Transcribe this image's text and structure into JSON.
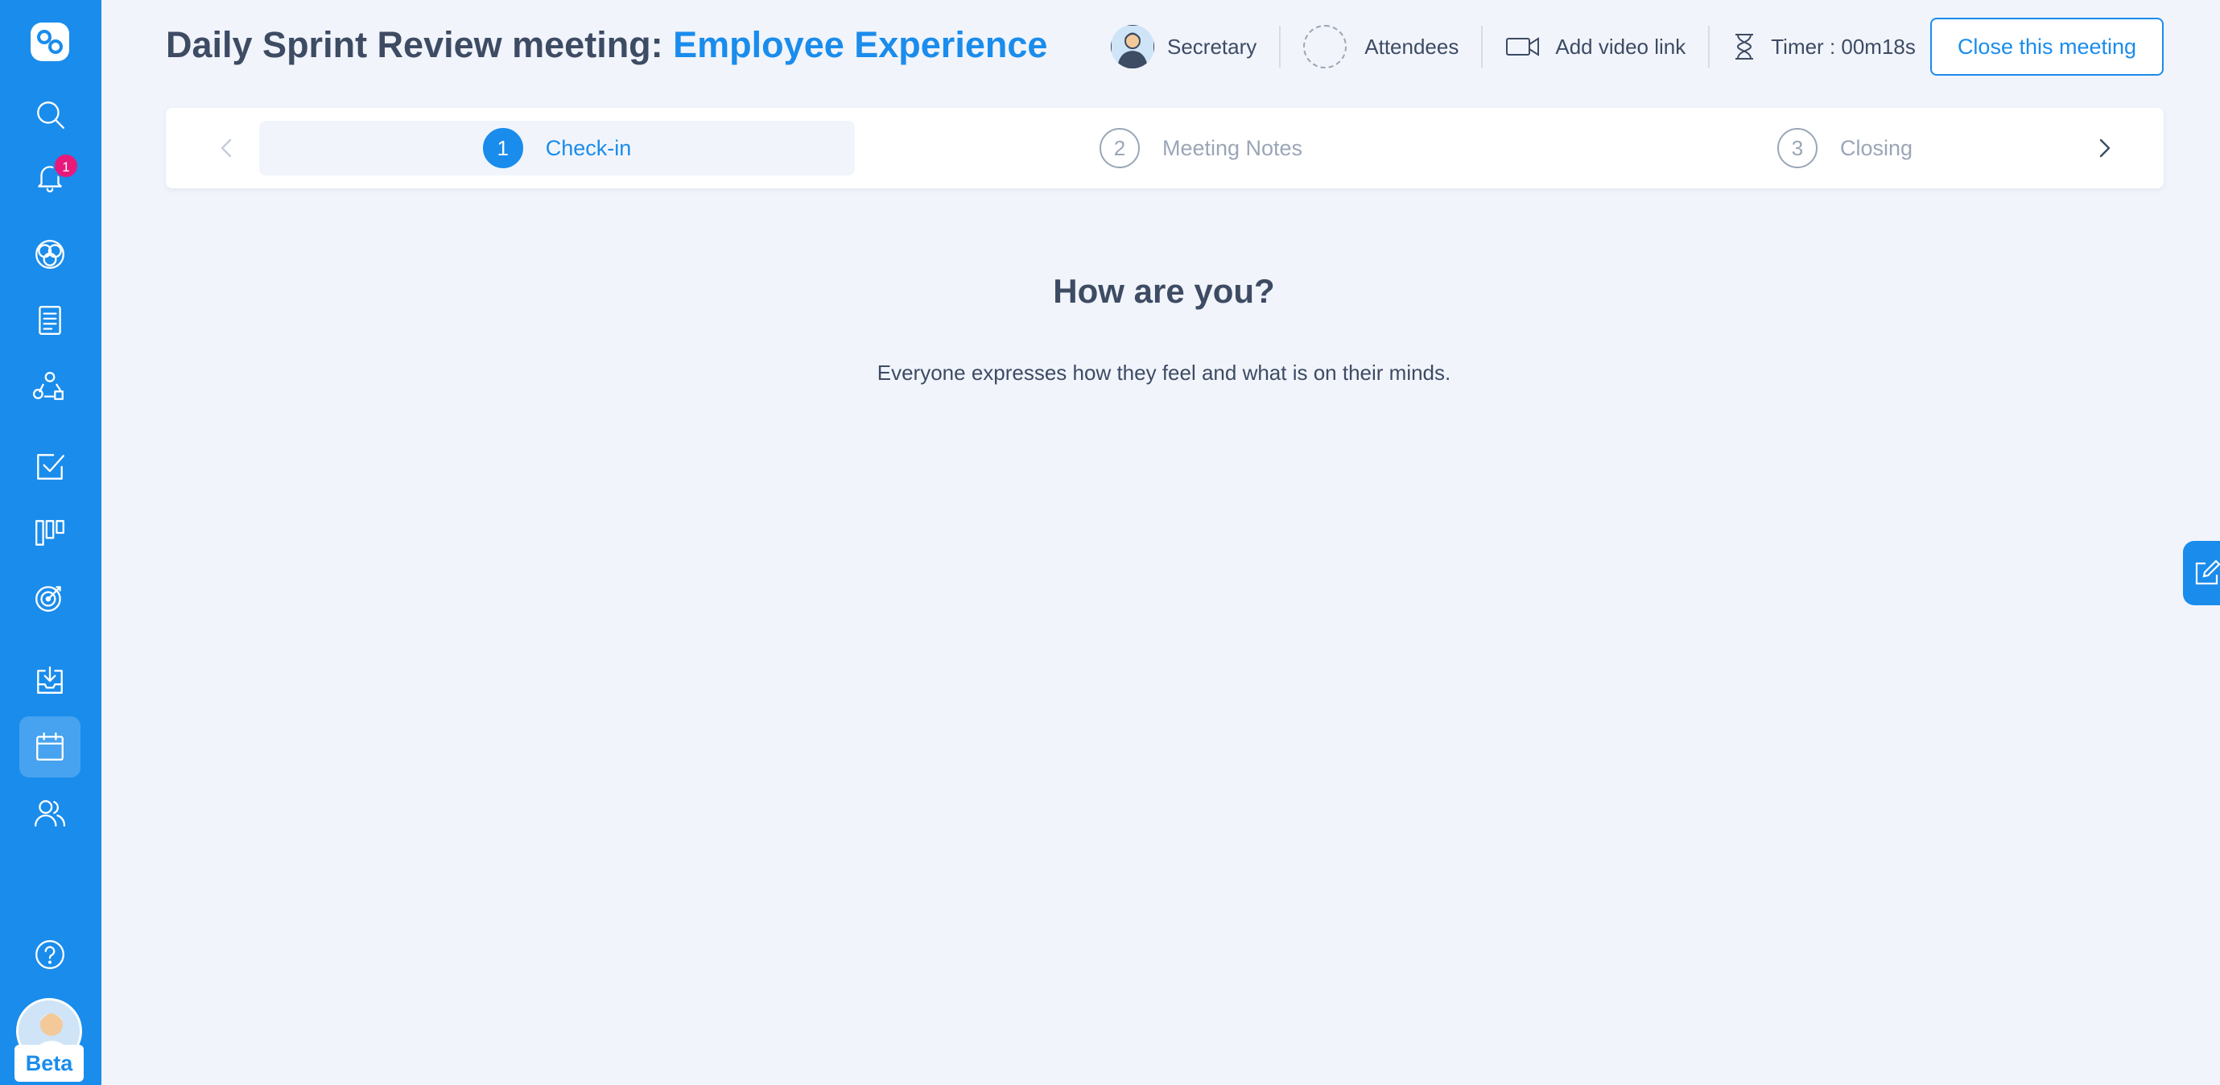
{
  "meeting": {
    "title_prefix": "Daily Sprint Review meeting: ",
    "title_accent": "Employee Experience"
  },
  "header": {
    "secretary_label": "Secretary",
    "attendees_label": "Attendees",
    "video_label": "Add video link",
    "timer_label": "Timer : 00m18s",
    "close_label": "Close this meeting"
  },
  "stepper": {
    "steps": [
      {
        "number": "1",
        "label": "Check-in",
        "active": true
      },
      {
        "number": "2",
        "label": "Meeting Notes",
        "active": false
      },
      {
        "number": "3",
        "label": "Closing",
        "active": false
      }
    ]
  },
  "content": {
    "heading": "How are you?",
    "description": "Everyone expresses how they feel and what is on their minds."
  },
  "sidebar": {
    "notification_count": "1",
    "beta_label": "Beta",
    "items": [
      {
        "name": "search-icon"
      },
      {
        "name": "bell-icon"
      },
      {
        "name": "circles-icon"
      },
      {
        "name": "document-icon"
      },
      {
        "name": "shapes-icon"
      },
      {
        "name": "checkbox-icon"
      },
      {
        "name": "kanban-icon"
      },
      {
        "name": "target-icon"
      },
      {
        "name": "inbox-icon"
      },
      {
        "name": "calendar-icon"
      },
      {
        "name": "users-icon"
      },
      {
        "name": "help-icon"
      }
    ]
  },
  "colors": {
    "brand": "#1a8cec",
    "badge": "#e8197b",
    "text": "#3d4b63",
    "muted": "#9aa6b6",
    "background": "#f1f4fb"
  }
}
